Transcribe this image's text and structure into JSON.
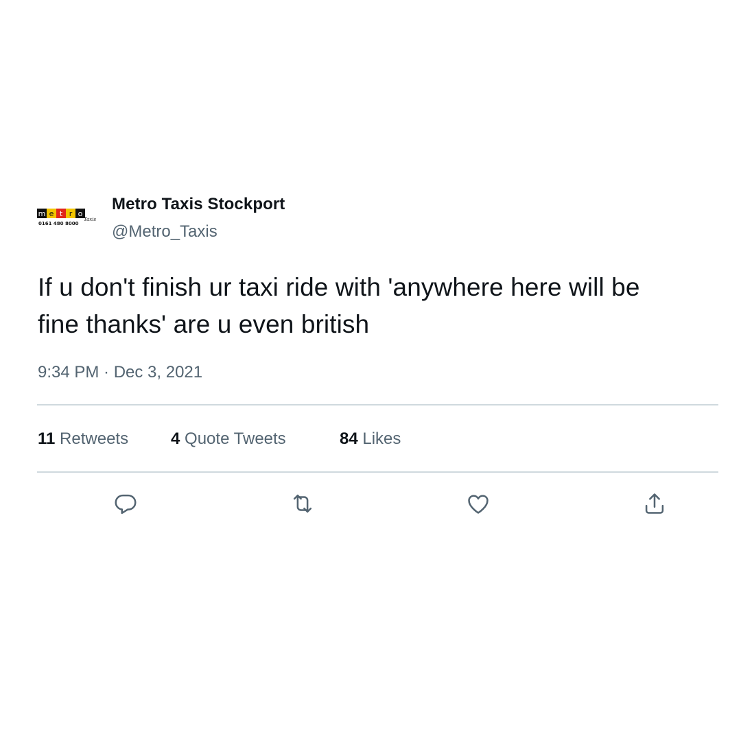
{
  "tweet": {
    "avatar": {
      "logo_letters": [
        "m",
        "e",
        "t",
        "r",
        "o"
      ],
      "logo_phone": "0161 480 8000",
      "logo_tag": "Taxis",
      "colors": [
        "#111111",
        "#f2c500",
        "#e0261b",
        "#f2c500",
        "#111111"
      ]
    },
    "display_name": "Metro Taxis Stockport",
    "handle": "@Metro_Taxis",
    "text_line1": "If u don't finish ur taxi ride with 'anywhere here will be",
    "text_line2": "fine thanks' are u even british",
    "timestamp": "9:34 PM · Dec 3, 2021",
    "stats": {
      "retweets_count": "11",
      "retweets_label": "Retweets",
      "quotes_count": "4",
      "quotes_label": "Quote Tweets",
      "likes_count": "84",
      "likes_label": "Likes"
    },
    "actions": {
      "reply_icon": "reply-icon",
      "retweet_icon": "retweet-icon",
      "like_icon": "like-icon",
      "share_icon": "share-icon"
    },
    "colors": {
      "text": "#0f1419",
      "secondary": "#536471",
      "divider": "#cfd9de",
      "icon": "#536471"
    }
  }
}
